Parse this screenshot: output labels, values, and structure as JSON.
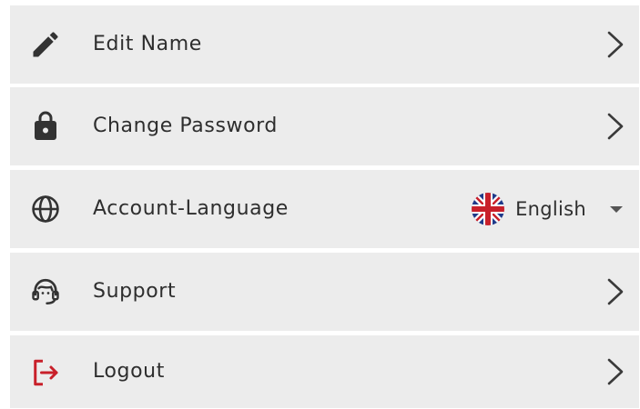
{
  "menu": {
    "items": [
      {
        "label": "Edit Name",
        "icon": "pencil-icon"
      },
      {
        "label": "Change Password",
        "icon": "lock-icon"
      },
      {
        "label": "Account-Language",
        "icon": "globe-icon",
        "value": "English",
        "value_icon": "uk-flag-icon"
      },
      {
        "label": "Support",
        "icon": "headset-icon"
      },
      {
        "label": "Logout",
        "icon": "logout-icon"
      }
    ]
  },
  "colors": {
    "row_background": "#ececec",
    "text": "#2e2e2e",
    "logout_icon": "#c8202a"
  }
}
